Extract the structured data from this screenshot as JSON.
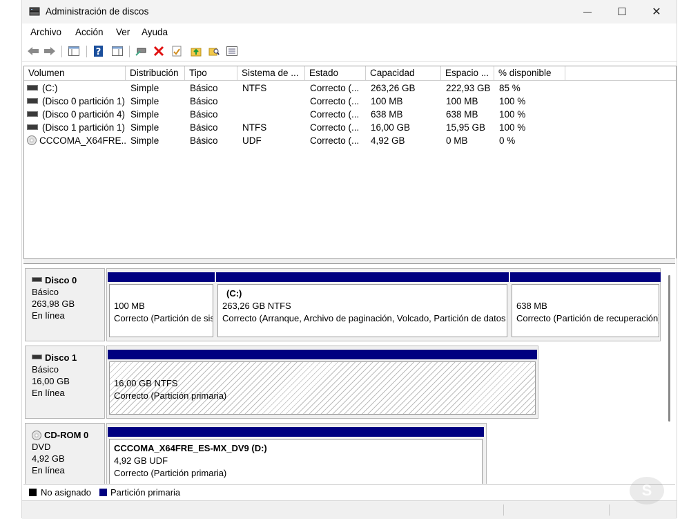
{
  "window": {
    "title": "Administración de discos",
    "controls": {
      "minimize": "—",
      "maximize": "☐",
      "close": "✕"
    }
  },
  "menu": [
    "Archivo",
    "Acción",
    "Ver",
    "Ayuda"
  ],
  "toolbar": {
    "icons": [
      "back-arrow-icon",
      "forward-arrow-icon",
      "console-tree-icon",
      "help-icon",
      "properties-view-icon",
      "connect-drive-icon",
      "delete-icon",
      "checklist-icon",
      "folder-up-icon",
      "search-folder-icon",
      "list-view-icon"
    ]
  },
  "columns": [
    "Volumen",
    "Distribución",
    "Tipo",
    "Sistema de ...",
    "Estado",
    "Capacidad",
    "Espacio ...",
    "% disponible"
  ],
  "rows": [
    {
      "icon": "disk",
      "vol": "(C:)",
      "dist": "Simple",
      "tipo": "Básico",
      "fs": "NTFS",
      "estado": "Correcto (...",
      "cap": "263,26 GB",
      "esp": "222,93 GB",
      "pct": "85 %"
    },
    {
      "icon": "disk",
      "vol": "(Disco 0 partición 1)",
      "dist": "Simple",
      "tipo": "Básico",
      "fs": "",
      "estado": "Correcto (...",
      "cap": "100 MB",
      "esp": "100 MB",
      "pct": "100 %"
    },
    {
      "icon": "disk",
      "vol": "(Disco 0 partición 4)",
      "dist": "Simple",
      "tipo": "Básico",
      "fs": "",
      "estado": "Correcto (...",
      "cap": "638 MB",
      "esp": "638 MB",
      "pct": "100 %"
    },
    {
      "icon": "disk",
      "vol": "(Disco 1 partición 1)",
      "dist": "Simple",
      "tipo": "Básico",
      "fs": "NTFS",
      "estado": "Correcto (...",
      "cap": "16,00 GB",
      "esp": "15,95 GB",
      "pct": "100 %"
    },
    {
      "icon": "cd",
      "vol": "CCCOMA_X64FRE...",
      "dist": "Simple",
      "tipo": "Básico",
      "fs": "UDF",
      "estado": "Correcto (...",
      "cap": "4,92 GB",
      "esp": "0 MB",
      "pct": "0 %"
    }
  ],
  "disks": [
    {
      "name": "Disco 0",
      "type": "Básico",
      "size": "263,98 GB",
      "status": "En línea",
      "partitions": [
        {
          "title": "",
          "line1": "100 MB",
          "line2": "Correcto (Partición de sistema EFI)"
        },
        {
          "title": "(C:)",
          "line1": "263,26 GB NTFS",
          "line2": "Correcto (Arranque, Archivo de paginación, Volcado, Partición de datos básicos)"
        },
        {
          "title": "",
          "line1": "638 MB",
          "line2": "Correcto (Partición de recuperación)"
        }
      ]
    },
    {
      "name": "Disco 1",
      "type": "Básico",
      "size": "16,00 GB",
      "status": "En línea",
      "partitions": [
        {
          "title": "",
          "line1": "16,00 GB NTFS",
          "line2": "Correcto (Partición primaria)"
        }
      ]
    },
    {
      "name": "CD-ROM 0",
      "type": "DVD",
      "size": "4,92 GB",
      "status": "En línea",
      "partitions": [
        {
          "title": "CCCOMA_X64FRE_ES-MX_DV9  (D:)",
          "line1": "4,92 GB UDF",
          "line2": "Correcto (Partición primaria)"
        }
      ]
    }
  ],
  "legend": [
    {
      "label": "No asignado",
      "color": "#000000"
    },
    {
      "label": "Partición primaria",
      "color": "#000080"
    }
  ],
  "watermark": "S"
}
